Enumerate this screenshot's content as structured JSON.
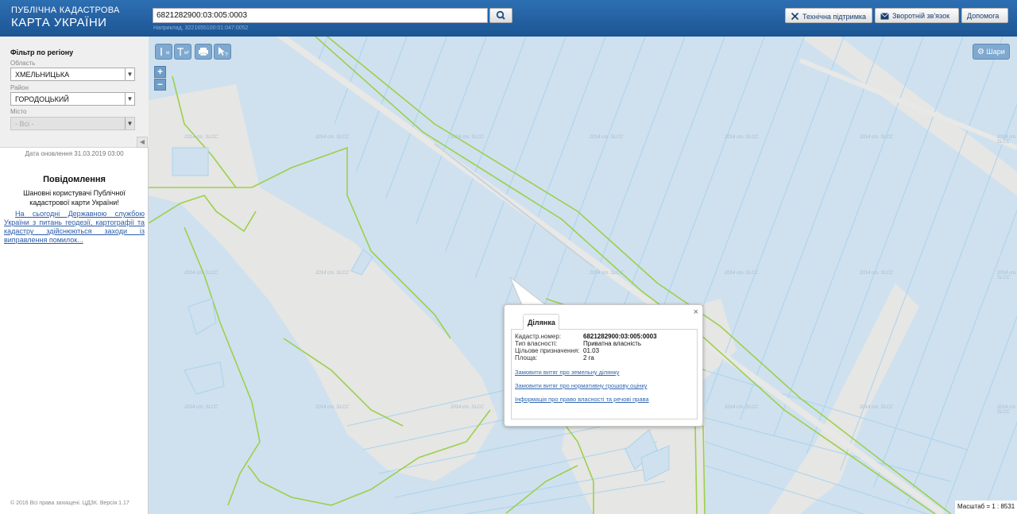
{
  "header": {
    "logo_line1": "ПУБЛІЧНА КАДАСТРОВА",
    "logo_line2": "КАРТА УКРАЇНИ",
    "search_value": "6821282900:03:005:0003",
    "search_hint": "Наприклад, 3221655100:01:047:0052",
    "buttons": {
      "support": "Технічна підтримка",
      "feedback": "Зворотній зв'язок",
      "help": "Допомога"
    }
  },
  "sidebar": {
    "filter_title": "Фільтр по регіону",
    "region_label": "Область",
    "region_value": "ХМЕЛЬНИЦЬКА",
    "district_label": "Район",
    "district_value": "ГОРОДОЦЬКИЙ",
    "city_label": "Місто",
    "city_value": "- Всі -",
    "update_date": "Дата оновлення  31.03.2019 03:00",
    "notice_title": "Повідомлення",
    "notice_greeting": "Шановні користувачі Публічної кадастрової карти України!",
    "notice_link": "На сьогодні Державною службою України з питань геодезії, картографії та кадастру здійснюються заходи із виправлення помилок...",
    "copyright": "© 2016 Всі права захищені. ЦДЗК. Версія 1.17"
  },
  "map": {
    "toolbar": {
      "measure_m": "м",
      "measure_m2": "м²"
    },
    "zoom_in": "+",
    "zoom_out": "−",
    "layers_label": "Шари",
    "scale_text": "Масштаб = 1 : 8531",
    "watermark": "2014 cm. SLCC"
  },
  "popup": {
    "tab_label": "Ділянка",
    "close": "×",
    "fields": [
      {
        "key": "Кадастр.номер:",
        "value": "6821282900:03:005:0003"
      },
      {
        "key": "Тип власності:",
        "value": "Приватна власність"
      },
      {
        "key": "Цільове призначення:",
        "value": "01.03"
      },
      {
        "key": "Площа:",
        "value": "2 га"
      }
    ],
    "links": [
      "Замовити витяг про земельну ділянку",
      "Замовити витяг про нормативну грошову оцінку",
      "Інформація про право власності та речові права"
    ]
  },
  "colors": {
    "header": "#2d6fb3",
    "parcel_fill": "#cfe1ee",
    "parcel_line": "#a9d3ef",
    "road_fill": "#e8e8e6",
    "boundary": "#9bd04b"
  }
}
